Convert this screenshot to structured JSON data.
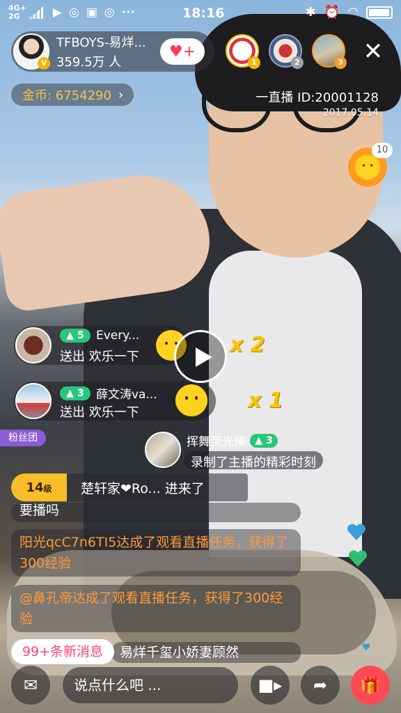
{
  "status_bar": {
    "network_top": "4G+",
    "network_bottom": "2G",
    "time": "18:16"
  },
  "host": {
    "name": "TFBOYS-易烊...",
    "fans": "359.5万 人",
    "follow_icon": "heart-plus-icon"
  },
  "top_viewers": [
    {
      "rank": "1",
      "color": "#f5b800"
    },
    {
      "rank": "2",
      "color": "#9aa0a8"
    },
    {
      "rank": "3",
      "color": "#f29b2e"
    }
  ],
  "coins": {
    "label": "金币: 6754290",
    "chevron": "›"
  },
  "live_id": "一直播 ID:20001128",
  "live_date": "2017.05.14",
  "floating_gift_count": "10",
  "gift_events": [
    {
      "level": "5",
      "user": "Every...",
      "message": "送出 欢乐一下",
      "multiplier": "x 2"
    },
    {
      "level": "3",
      "user": "薛文涛va...",
      "message": "送出 欢乐一下",
      "multiplier": "x 1"
    }
  ],
  "fan_club_badge": "粉丝团",
  "record_event": {
    "user": "挥舞荧光棒",
    "level": "3",
    "message": "录制了主播的精彩时刻"
  },
  "enter_event": {
    "level": "14",
    "level_suffix": "级",
    "text": "楚轩家❤Ro... 进来了"
  },
  "chat": {
    "cut_line": "要播吗",
    "messages": [
      "阳光qcC7n6TI5达成了观看直播任务，获得了300经验",
      "@鼻孔帝达成了观看直播任务，获得了300经验"
    ],
    "partial_last": "易烊千玺小娇妻顾然"
  },
  "new_messages": "99+条新消息",
  "bottom_bar": {
    "comment_placeholder": "说点什么吧 ...",
    "icons": [
      "message-icon",
      "video-camera-icon",
      "share-icon",
      "gift-icon"
    ]
  }
}
